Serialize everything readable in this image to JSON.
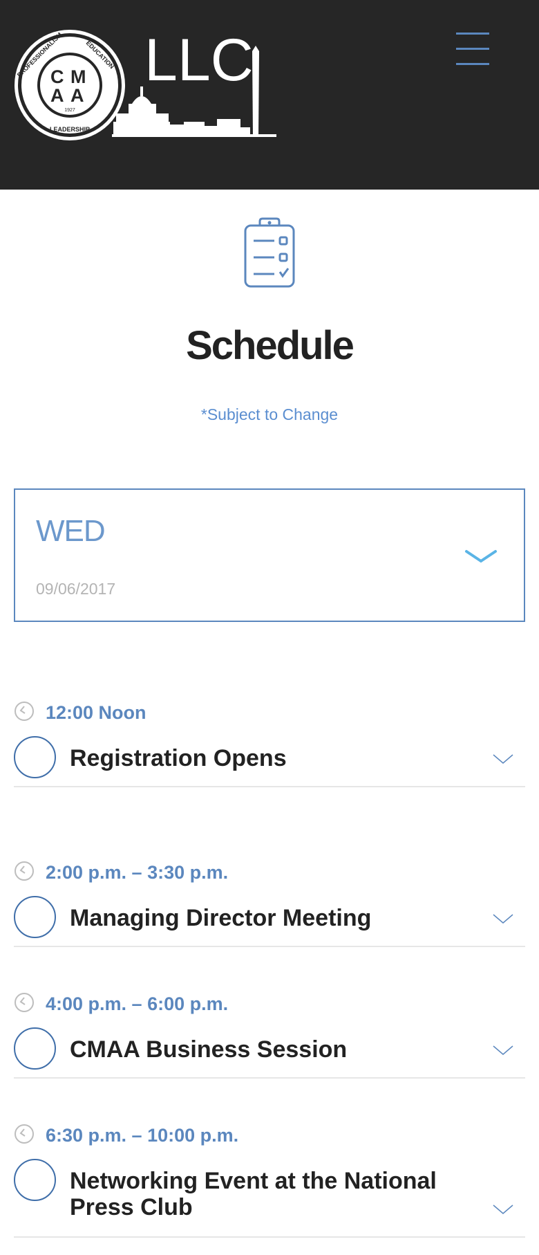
{
  "header": {
    "logo": {
      "seal_text": [
        "PROFESSIONALISM",
        "EDUCATION",
        "LEADERSHIP",
        "1927"
      ],
      "seal_letters": [
        "C",
        "M",
        "A",
        "A"
      ],
      "registered_mark": "®",
      "wordmark": "LLC"
    },
    "menu_icon": "hamburger-icon"
  },
  "page": {
    "icon": "clipboard-checklist-icon",
    "title": "Schedule",
    "subtitle": "*Subject to Change"
  },
  "day_select": {
    "day": "WED",
    "date": "09/06/2017",
    "icon": "chevron-down-icon"
  },
  "events": [
    {
      "time": "12:00 Noon",
      "title": "Registration Opens"
    },
    {
      "time": "2:00 p.m. – 3:30 p.m.",
      "title": "Managing Director Meeting"
    },
    {
      "time": "4:00 p.m. – 6:00 p.m.",
      "title": "CMAA Business Session"
    },
    {
      "time": "6:30 p.m. – 10:00 p.m.",
      "title_line1": "Networking Event at the National",
      "title_line2": "Press Club"
    }
  ],
  "colors": {
    "header_bg": "#262626",
    "accent_blue": "#5b87be",
    "light_blue": "#6c98cc",
    "chevron_blue": "#5ab4e6",
    "divider": "#e6e6e6"
  }
}
